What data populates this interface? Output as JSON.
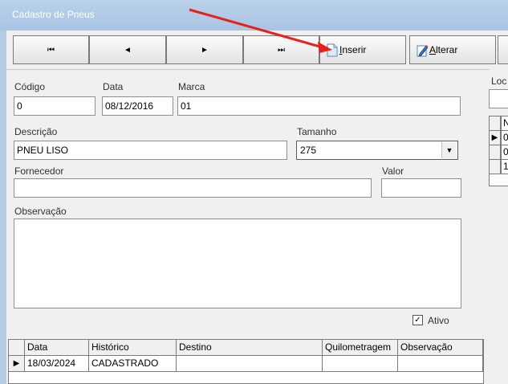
{
  "window": {
    "title": "Cadastro de Pneus"
  },
  "nav": {
    "first_glyph": "⏮",
    "prev_glyph": "◄",
    "next_glyph": "►",
    "last_glyph": "⏭"
  },
  "actions": {
    "insert_label_mnemonic": "I",
    "insert_label_rest": "nserir",
    "alter_label_mnemonic": "A",
    "alter_label_rest": "lterar"
  },
  "form": {
    "codigo_label": "Código",
    "codigo_value": "0",
    "data_label": "Data",
    "data_value": "08/12/2016",
    "marca_label": "Marca",
    "marca_value": "01",
    "descricao_label": "Descrição",
    "descricao_value": "PNEU LISO",
    "tamanho_label": "Tamanho",
    "tamanho_value": "275",
    "fornecedor_label": "Fornecedor",
    "fornecedor_value": "",
    "valor_label": "Valor",
    "valor_value": "",
    "observacao_label": "Observação",
    "observacao_value": "",
    "ativo_label": "Ativo",
    "ativo_checked": true,
    "check_glyph": "✓"
  },
  "history_grid": {
    "columns": [
      "Data",
      "Histórico",
      "Destino",
      "Quilometragem",
      "Observação"
    ],
    "rows": [
      {
        "indicator": "▶",
        "data": "18/03/2024",
        "historico": "CADASTRADO",
        "destino": "",
        "quilometragem": "",
        "observacao": ""
      }
    ]
  },
  "right_panel": {
    "label": "Loc",
    "rows": [
      {
        "indicator": "",
        "text": "N"
      },
      {
        "indicator": "▶",
        "text": "0"
      },
      {
        "indicator": "",
        "text": "0"
      },
      {
        "indicator": "",
        "text": "1"
      }
    ]
  },
  "annotation": {
    "arrow_color": "#e8201c"
  }
}
